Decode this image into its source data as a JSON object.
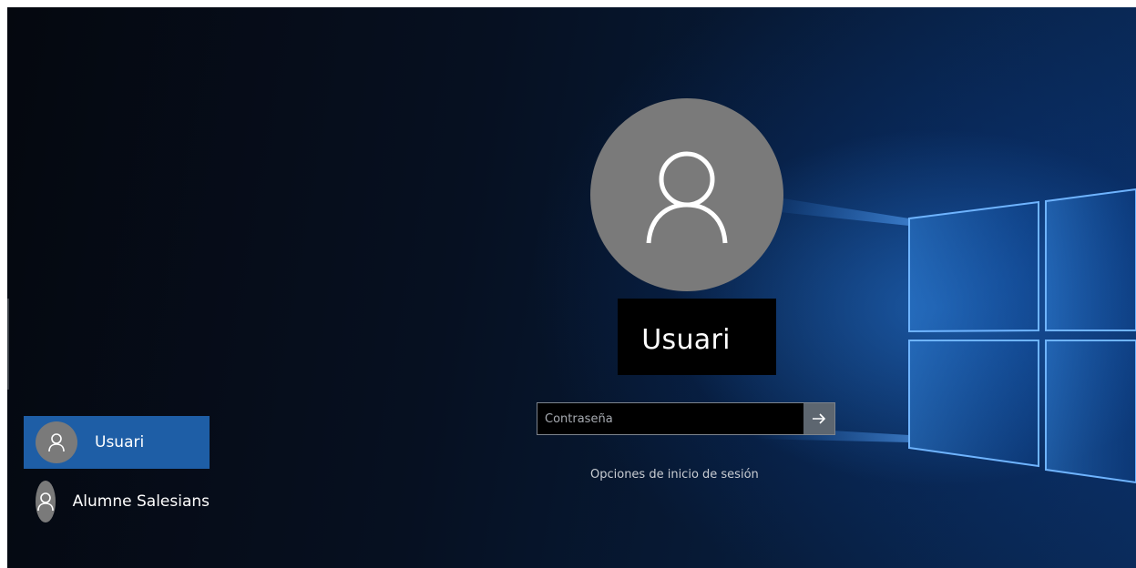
{
  "current_user": {
    "name": "Usuari",
    "avatar_icon": "user-icon"
  },
  "password": {
    "placeholder": "Contraseña",
    "value": "",
    "submit_icon": "arrow-right-icon"
  },
  "signin_options_label": "Opciones de inicio de sesión",
  "user_list": [
    {
      "name": "Usuari",
      "selected": true,
      "avatar_icon": "user-icon"
    },
    {
      "name": "Alumne Salesians",
      "selected": false,
      "avatar_icon": "user-icon"
    }
  ],
  "colors": {
    "selected_tile": "#1e5ea6",
    "avatar_bg": "#7a7a7a",
    "submit_button": "#5d6670"
  }
}
